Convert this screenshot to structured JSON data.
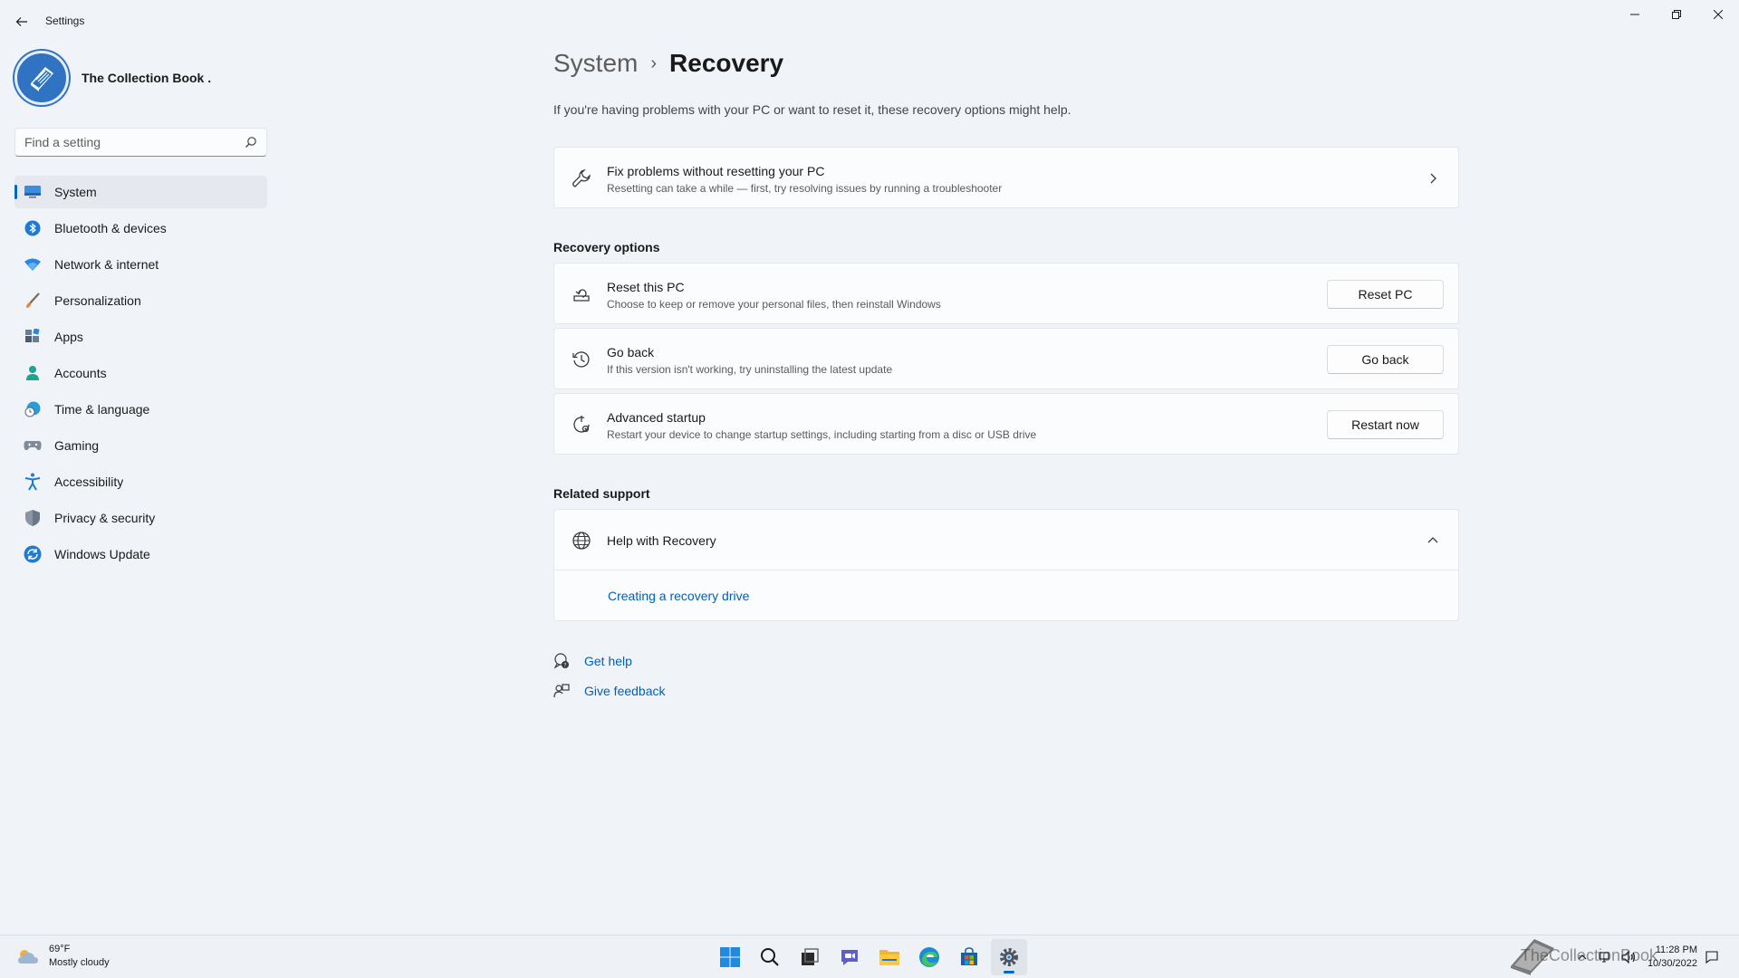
{
  "window": {
    "title": "Settings"
  },
  "profile": {
    "name": "The Collection Book ."
  },
  "search": {
    "placeholder": "Find a setting"
  },
  "sidebar": {
    "items": [
      {
        "label": "System",
        "icon": "monitor-icon",
        "active": true
      },
      {
        "label": "Bluetooth & devices",
        "icon": "bluetooth-icon"
      },
      {
        "label": "Network & internet",
        "icon": "wifi-icon"
      },
      {
        "label": "Personalization",
        "icon": "brush-icon"
      },
      {
        "label": "Apps",
        "icon": "apps-icon"
      },
      {
        "label": "Accounts",
        "icon": "person-icon"
      },
      {
        "label": "Time & language",
        "icon": "globe-clock-icon"
      },
      {
        "label": "Gaming",
        "icon": "gamepad-icon"
      },
      {
        "label": "Accessibility",
        "icon": "accessibility-icon"
      },
      {
        "label": "Privacy & security",
        "icon": "shield-icon"
      },
      {
        "label": "Windows Update",
        "icon": "update-icon"
      }
    ]
  },
  "breadcrumb": {
    "parent": "System",
    "separator": "›",
    "current": "Recovery"
  },
  "description": "If you're having problems with your PC or want to reset it, these recovery options might help.",
  "fix_card": {
    "title": "Fix problems without resetting your PC",
    "subtitle": "Resetting can take a while — first, try resolving issues by running a troubleshooter"
  },
  "recovery_options": {
    "heading": "Recovery options",
    "items": [
      {
        "title": "Reset this PC",
        "subtitle": "Choose to keep or remove your personal files, then reinstall Windows",
        "button": "Reset PC"
      },
      {
        "title": "Go back",
        "subtitle": "If this version isn't working, try uninstalling the latest update",
        "button": "Go back"
      },
      {
        "title": "Advanced startup",
        "subtitle": "Restart your device to change startup settings, including starting from a disc or USB drive",
        "button": "Restart now"
      }
    ]
  },
  "related_support": {
    "heading": "Related support",
    "help_title": "Help with Recovery",
    "link": "Creating a recovery drive"
  },
  "help_links": {
    "get_help": "Get help",
    "give_feedback": "Give feedback"
  },
  "taskbar": {
    "weather_temp": "69°F",
    "weather_desc": "Mostly cloudy",
    "time": "11:28 PM",
    "date": "10/30/2022",
    "watermark": "TheCollectionBook"
  },
  "colors": {
    "accent": "#0067c0",
    "link": "#005fb8",
    "background": "#f0f4f9",
    "card": "#fbfcfd"
  }
}
